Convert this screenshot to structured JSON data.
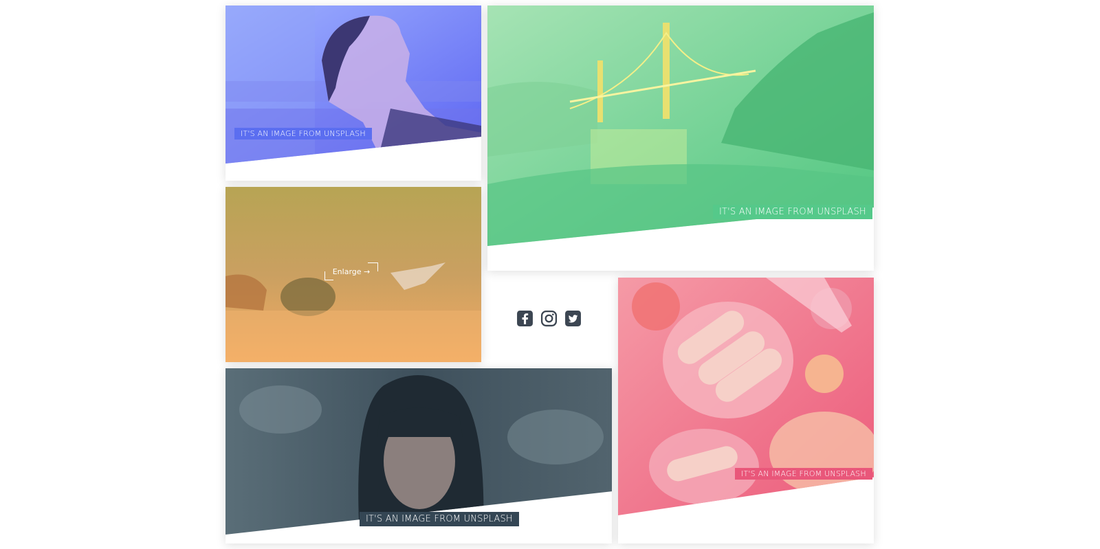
{
  "cards": [
    {
      "caption": "IT'S AN IMAGE FROM UNSPLASH",
      "tint": "#6b7cff",
      "subject": "man-lying-head-back"
    },
    {
      "caption": "IT'S AN IMAGE FROM UNSPLASH",
      "tint": "#5cd08f",
      "subject": "golden-gate-bridge-at-night"
    },
    {
      "enlarge_label": "Enlarge →",
      "tint": "#f0a352",
      "subject": "diver-and-sea-turtle"
    },
    {
      "caption": "IT'S AN IMAGE FROM UNSPLASH",
      "tint": "#34485a",
      "subject": "woman-portrait-with-bangs"
    },
    {
      "caption": "IT'S AN IMAGE FROM UNSPLASH",
      "tint": "#ef5a7a",
      "subject": "hot-dogs-and-chips-table"
    }
  ],
  "social": [
    "facebook-icon",
    "instagram-icon",
    "twitter-icon"
  ],
  "colors": {
    "blue_caption_bg": "#5b6ef0",
    "green_caption_bg": "#55c98a",
    "dark_caption_bg": "#344654",
    "pink_caption_bg": "#e9577a",
    "social_icon": "#3c4652"
  }
}
